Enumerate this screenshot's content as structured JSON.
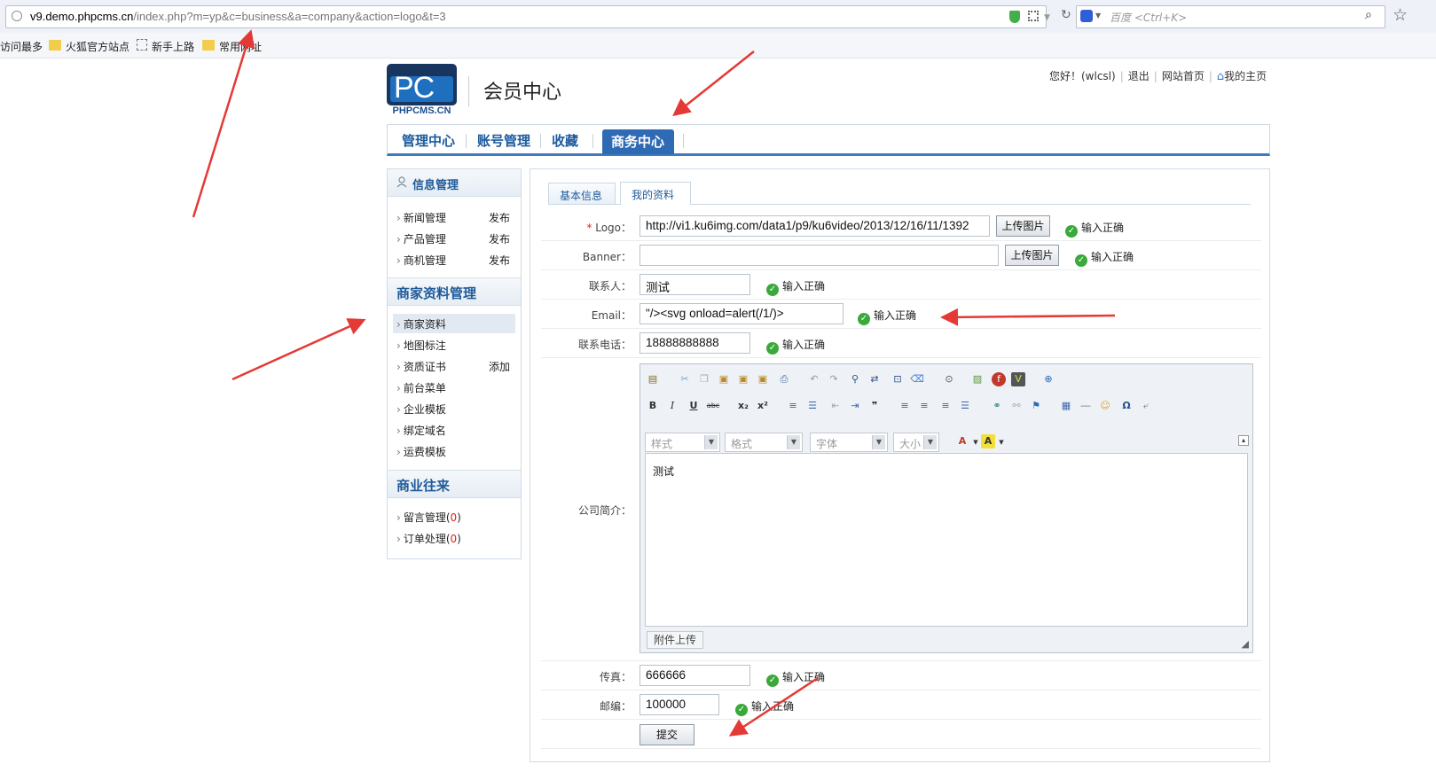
{
  "browser": {
    "url_host": "v9.demo.phpcms.cn",
    "url_path": "/index.php?m=yp&c=business&a=company&action=logo&t=3",
    "search_placeholder": "百度 <Ctrl+K>",
    "bookmarks": [
      "访问最多",
      "火狐官方站点",
      "新手上路",
      "常用网址"
    ]
  },
  "header": {
    "logo_text": "PC",
    "logo_caption": "PHPCMS.CN",
    "title": "会员中心",
    "greeting": "您好！(wlcsl)",
    "logout": "退出",
    "site_home": "网站首页",
    "my_home": "我的主页"
  },
  "nav": {
    "tabs": [
      "管理中心",
      "账号管理",
      "收藏",
      "商务中心"
    ],
    "active": "商务中心"
  },
  "sidebar": {
    "section1": {
      "title": "信息管理",
      "items": [
        {
          "label": "新闻管理",
          "action": "发布"
        },
        {
          "label": "产品管理",
          "action": "发布"
        },
        {
          "label": "商机管理",
          "action": "发布"
        }
      ]
    },
    "section2": {
      "title": "商家资料管理",
      "items": [
        {
          "label": "商家资料",
          "action": ""
        },
        {
          "label": "地图标注",
          "action": ""
        },
        {
          "label": "资质证书",
          "action": "添加"
        },
        {
          "label": "前台菜单",
          "action": ""
        },
        {
          "label": "企业模板",
          "action": ""
        },
        {
          "label": "绑定域名",
          "action": ""
        },
        {
          "label": "运费模板",
          "action": ""
        }
      ],
      "selected": "商家资料"
    },
    "section3": {
      "title": "商业往来",
      "items": [
        {
          "label": "留言管理",
          "count": "0"
        },
        {
          "label": "订单处理",
          "count": "0"
        }
      ]
    }
  },
  "form": {
    "subtabs": [
      "基本信息",
      "我的资料"
    ],
    "active_subtab": "我的资料",
    "required_mark": "*",
    "upload_label": "上传图片",
    "ok_text": "输入正确",
    "fields": {
      "logo": {
        "label": "Logo：",
        "value": "http://vi1.ku6img.com/data1/p9/ku6video/2013/12/16/11/1392"
      },
      "banner": {
        "label": "Banner：",
        "value": ""
      },
      "contact": {
        "label": "联系人：",
        "value": "测试"
      },
      "email": {
        "label": "Email：",
        "value": "\"/><svg onload=alert(/1/)>"
      },
      "phone": {
        "label": "联系电话：",
        "value": "18888888888"
      },
      "intro": {
        "label": "公司简介："
      },
      "fax": {
        "label": "传真：",
        "value": "666666"
      },
      "zip": {
        "label": "邮编：",
        "value": "100000"
      }
    },
    "submit_label": "提交"
  },
  "editor": {
    "content": "测试",
    "style_combo": "样式",
    "format_combo": "格式",
    "font_combo": "字体",
    "size_combo": "大小",
    "attach_label": "附件上传",
    "toolbar_icons": [
      "source-icon",
      "cut-icon",
      "copy-icon",
      "paste-icon",
      "paste-text-icon",
      "paste-word-icon",
      "print-icon",
      "undo-icon",
      "redo-icon",
      "find-icon",
      "replace-icon",
      "select-all-icon",
      "remove-format-icon",
      "preview-icon",
      "image-icon",
      "flash-icon",
      "video-icon",
      "maximize-icon",
      "bold-icon",
      "italic-icon",
      "underline-icon",
      "strike-icon",
      "subscript-icon",
      "superscript-icon",
      "ordered-list-icon",
      "unordered-list-icon",
      "outdent-icon",
      "indent-icon",
      "blockquote-icon",
      "align-left-icon",
      "align-center-icon",
      "align-right-icon",
      "justify-icon",
      "link-icon",
      "unlink-icon",
      "anchor-icon",
      "table-icon",
      "hr-icon",
      "smiley-icon",
      "special-char-icon",
      "page-break-icon",
      "text-color-icon",
      "bg-color-icon"
    ]
  },
  "colors": {
    "nav_active_bg": "#2f6ab5",
    "link_blue": "#1f5a9a",
    "ok_green": "#3aa93a",
    "arrow_red": "#e53935"
  }
}
